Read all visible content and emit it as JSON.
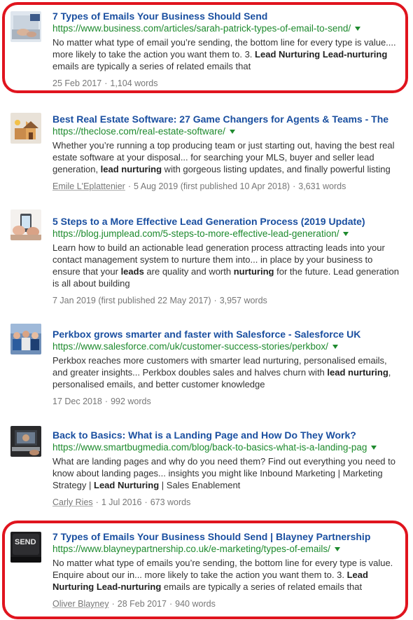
{
  "results": [
    {
      "title": "7 Types of Emails Your Business Should Send",
      "url": "https://www.business.com/articles/sarah-patrick-types-of-email-to-send/",
      "snippet": [
        {
          "t": "No matter what type of email you’re sending, the bottom line for every type is value.... more likely to take the action you want them to. 3. ",
          "b": false
        },
        {
          "t": "Lead Nurturing Lead-nurturing",
          "b": true
        },
        {
          "t": " emails are typically a series of related emails that",
          "b": false
        }
      ],
      "author": "",
      "date": "25 Feb 2017",
      "words": "1,104 words",
      "thumb_icon": "laptop-typing-thumbnail"
    },
    {
      "title": "Best Real Estate Software: 27 Game Changers for Agents & Teams - The",
      "url": "https://theclose.com/real-estate-software/",
      "snippet": [
        {
          "t": "Whether you’re running a top producing team or just starting out, having the best real estate software at your disposal... for searching your MLS, buyer and seller lead generation, ",
          "b": false
        },
        {
          "t": "lead nurturing",
          "b": true
        },
        {
          "t": " with gorgeous listing updates, and finally powerful listing",
          "b": false
        }
      ],
      "author": "Emile L'Eplattenier",
      "date": "5 Aug 2019 (first published 10 Apr 2018)",
      "words": "3,631 words",
      "thumb_icon": "house-boxes-thumbnail"
    },
    {
      "title": "5 Steps to a More Effective Lead Generation Process (2019 Update)",
      "url": "https://blog.jumplead.com/5-steps-to-more-effective-lead-generation/",
      "snippet": [
        {
          "t": "Learn how to build an actionable lead generation process attracting leads into your contact management system to nurture them into... in place by your business to ensure that your ",
          "b": false
        },
        {
          "t": "leads",
          "b": true
        },
        {
          "t": " are quality and worth ",
          "b": false
        },
        {
          "t": "nurturing",
          "b": true
        },
        {
          "t": " for the future. Lead generation is all about building",
          "b": false
        }
      ],
      "author": "",
      "date": "7 Jan 2019 (first published 22 May 2017)",
      "words": "3,957 words",
      "thumb_icon": "hands-phone-thumbnail"
    },
    {
      "title": "Perkbox grows smarter and faster with Salesforce - Salesforce UK",
      "url": "https://www.salesforce.com/uk/customer-success-stories/perkbox/",
      "snippet": [
        {
          "t": "Perkbox reaches more customers with smarter lead nurturing, personalised emails, and greater insights... Perkbox doubles sales and halves churn with ",
          "b": false
        },
        {
          "t": "lead nurturing",
          "b": true
        },
        {
          "t": ", personalised emails, and better customer knowledge",
          "b": false
        }
      ],
      "author": "",
      "date": "17 Dec 2018",
      "words": "992 words",
      "thumb_icon": "team-photo-thumbnail"
    },
    {
      "title": "Back to Basics: What is a Landing Page and How Do They Work?",
      "url": "https://www.smartbugmedia.com/blog/back-to-basics-what-is-a-landing-pag",
      "snippet": [
        {
          "t": "What are landing pages and why do you need them? Find out everything you need to know about landing pages... insights you might like Inbound Marketing | Marketing Strategy | ",
          "b": false
        },
        {
          "t": "Lead Nurturing",
          "b": true
        },
        {
          "t": " | Sales Enablement",
          "b": false
        }
      ],
      "author": "Carly Ries",
      "date": "1 Jul 2016",
      "words": "673 words",
      "thumb_icon": "laptop-screen-thumbnail"
    },
    {
      "title": "7 Types of Emails Your Business Should Send | Blayney Partnership",
      "url": "https://www.blayneypartnership.co.uk/e-marketing/types-of-emails/",
      "snippet": [
        {
          "t": "No matter what type of emails you’re sending, the bottom line for every type is value. Enquire about our in... more likely to take the action you want them to. 3. ",
          "b": false
        },
        {
          "t": "Lead Nurturing Lead-nurturing",
          "b": true
        },
        {
          "t": " emails are typically a series of related emails that",
          "b": false
        }
      ],
      "author": "Oliver Blayney",
      "date": "28 Feb 2017",
      "words": "940 words",
      "thumb_icon": "send-key-thumbnail",
      "thumb_text": "SEND"
    }
  ],
  "colors": {
    "title": "#1a4fa0",
    "url": "#1e8a2e",
    "highlight": "#e0141e"
  }
}
